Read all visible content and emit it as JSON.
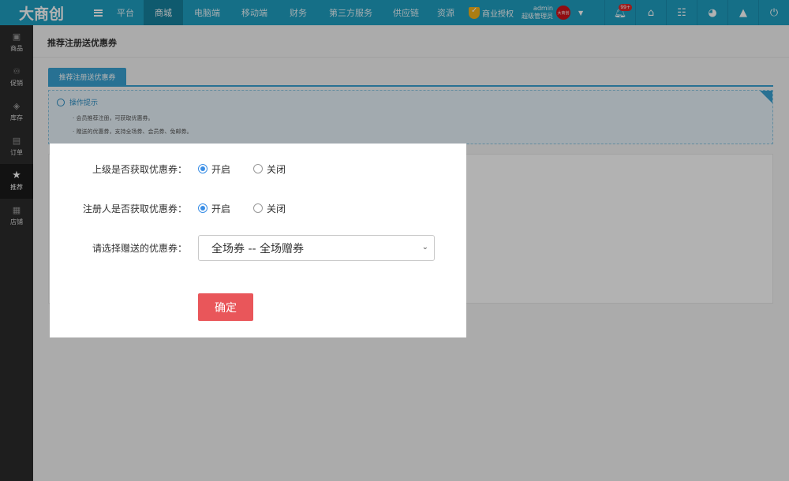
{
  "app": {
    "logo": "大商创"
  },
  "nav": {
    "items": [
      "平台",
      "商城",
      "电脑端",
      "移动端",
      "财务",
      "第三方服务",
      "供应链",
      "资源"
    ],
    "auth_label": "商业授权",
    "admin_name": "admin",
    "admin_role": "超级管理员",
    "avatar_text": "大商创",
    "notif_badge": "99+"
  },
  "sidebar": {
    "items": [
      {
        "label": "商品",
        "icon": "bag-icon"
      },
      {
        "label": "促销",
        "icon": "promo-icon"
      },
      {
        "label": "库存",
        "icon": "tag-icon"
      },
      {
        "label": "订单",
        "icon": "order-icon"
      },
      {
        "label": "推荐",
        "icon": "star-icon"
      },
      {
        "label": "店铺",
        "icon": "store-icon"
      }
    ]
  },
  "page": {
    "title": "推荐注册送优惠券",
    "tab": "推荐注册送优惠券",
    "tips_title": "操作提示",
    "tips": [
      "会员推荐注册，可获取优惠券。",
      "赠送的优惠券，支持全场券、会员券、免邮券。"
    ]
  },
  "modal": {
    "rows": [
      {
        "label": "上级是否获取优惠券：",
        "on": "开启",
        "off": "关闭"
      },
      {
        "label": "注册人是否获取优惠券：",
        "on": "开启",
        "off": "关闭"
      }
    ],
    "select_label": "请选择赠送的优惠券：",
    "select_value": "全场券 -- 全场赠券",
    "confirm": "确定"
  },
  "colors": {
    "topbar": "#1f9fc2",
    "active_nav": "#16819e",
    "sidebar": "#2b2b2b",
    "accent": "#3aa3d3",
    "confirm": "#e9565a"
  }
}
